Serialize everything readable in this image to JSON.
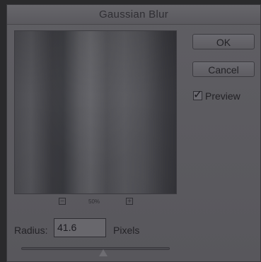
{
  "dialog": {
    "title": "Gaussian Blur",
    "zoom": {
      "out_symbol": "−",
      "level": "50%",
      "in_symbol": "+"
    },
    "buttons": {
      "ok": "OK",
      "cancel": "Cancel"
    },
    "preview": {
      "label": "Preview",
      "checked": true,
      "checkmark": "✓"
    },
    "radius": {
      "label": "Radius:",
      "value": "41.6",
      "unit": "Pixels",
      "slider_fraction": 0.55
    }
  }
}
